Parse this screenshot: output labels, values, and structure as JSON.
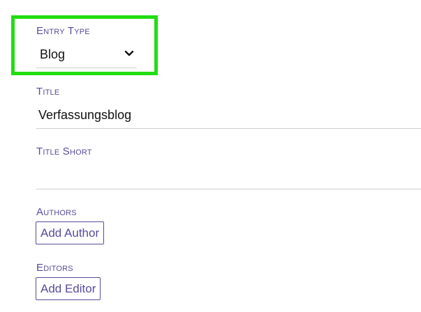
{
  "form": {
    "entry_type": {
      "label": "Entry Type",
      "selected": "Blog",
      "icon": "chevron-down-icon"
    },
    "title": {
      "label": "Title",
      "value": "Verfassungsblog"
    },
    "title_short": {
      "label": "Title Short",
      "value": ""
    },
    "authors": {
      "label": "Authors",
      "button_label": "Add Author"
    },
    "editors": {
      "label": "Editors",
      "button_label": "Add Editor"
    }
  },
  "colors": {
    "accent": "#5a4a98",
    "highlight": "#22dd11",
    "divider": "#cfcfcf",
    "text": "#111111"
  }
}
